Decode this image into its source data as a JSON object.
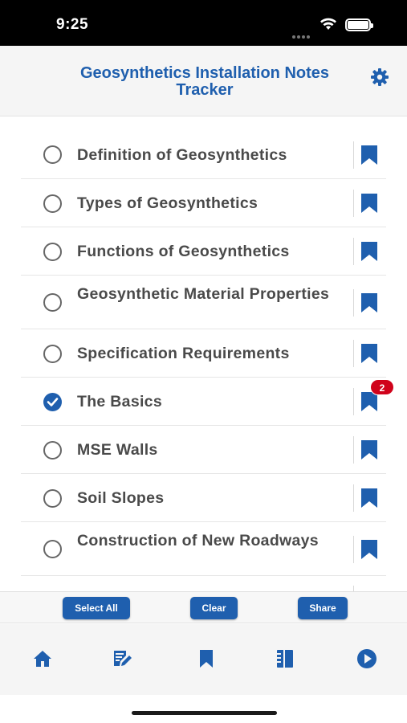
{
  "status_bar": {
    "time": "9:25"
  },
  "header": {
    "title": "Geosynthetics Installation Notes Tracker"
  },
  "topics": [
    {
      "label": "Definition of Geosynthetics",
      "checked": false,
      "badge": ""
    },
    {
      "label": "Types of Geosynthetics",
      "checked": false,
      "badge": ""
    },
    {
      "label": "Functions of Geosynthetics",
      "checked": false,
      "badge": ""
    },
    {
      "label": "Geosynthetic Material Properties",
      "checked": false,
      "badge": ""
    },
    {
      "label": "Specification Requirements",
      "checked": false,
      "badge": ""
    },
    {
      "label": "The Basics",
      "checked": true,
      "badge": "2"
    },
    {
      "label": "MSE Walls",
      "checked": false,
      "badge": ""
    },
    {
      "label": "Soil Slopes",
      "checked": false,
      "badge": ""
    },
    {
      "label": "Construction of New Roadways",
      "checked": false,
      "badge": ""
    }
  ],
  "actions": {
    "select_all": "Select All",
    "clear": "Clear",
    "share": "Share"
  },
  "tabs": [
    {
      "icon": "home-icon"
    },
    {
      "icon": "notes-edit-icon"
    },
    {
      "icon": "bookmark-icon"
    },
    {
      "icon": "checklist-icon"
    },
    {
      "icon": "play-icon"
    }
  ],
  "colors": {
    "accent": "#1f5fae",
    "badge": "#d0021b",
    "text": "#4a4a4a"
  }
}
